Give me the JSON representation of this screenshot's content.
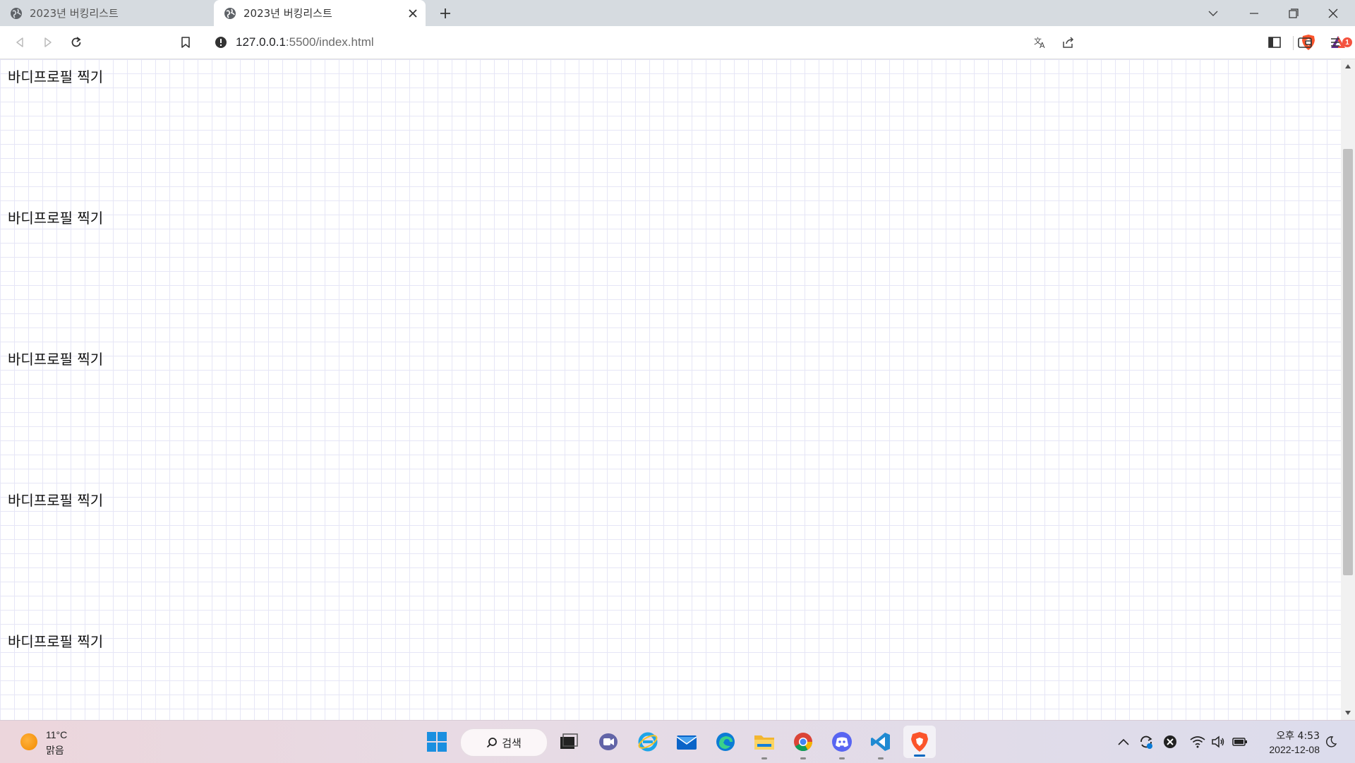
{
  "browser": {
    "tabs": [
      {
        "title": "2023년 버킹리스트",
        "active": false
      },
      {
        "title": "2023년 버킹리스트",
        "active": true
      }
    ],
    "address": {
      "host": "127.0.0.1",
      "path": ":5500/index.html"
    },
    "notification_count": "1",
    "accent_color": "#fb542b"
  },
  "page": {
    "items": [
      "바디프로필 찍기",
      "바디프로필 찍기",
      "바디프로필 찍기",
      "바디프로필 찍기",
      "바디프로필 찍기"
    ]
  },
  "taskbar": {
    "weather": {
      "temp": "11°C",
      "condition": "맑음"
    },
    "search_label": "검색",
    "apps": [
      "start-icon",
      "search",
      "task-view-icon",
      "teams-icon",
      "internet-explorer-icon",
      "mail-icon",
      "edge-icon",
      "file-explorer-icon",
      "chrome-icon",
      "discord-icon",
      "vscode-icon",
      "brave-icon"
    ],
    "clock": {
      "time": "오후 4:53",
      "date": "2022-12-08"
    }
  }
}
